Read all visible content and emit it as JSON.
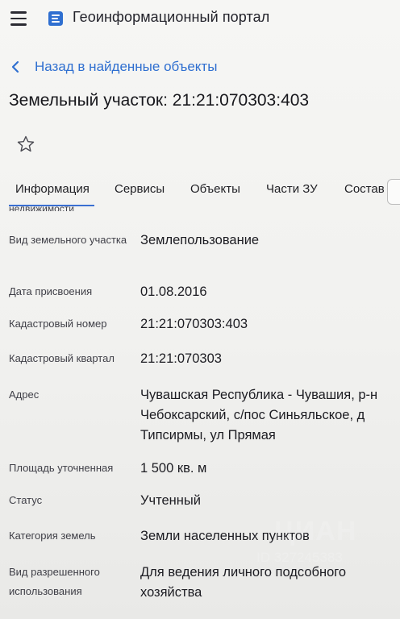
{
  "header": {
    "portal_title": "Геоинформационный портал",
    "menu_icon": "hamburger-menu-icon",
    "logo_icon": "portal-logo-icon"
  },
  "back": {
    "label": "Назад в найденные объекты",
    "icon": "chevron-left-icon"
  },
  "object": {
    "title": "Земельный участок: 21:21:070303:403",
    "favorite_icon": "star-outline-icon"
  },
  "tabs": {
    "items": [
      "Информация",
      "Сервисы",
      "Объекты",
      "Части ЗУ",
      "Состав"
    ],
    "active": "Информация",
    "overflow_label": "недвижимости"
  },
  "fields": [
    {
      "label": "Вид земельного участка",
      "value": "Землепользование"
    },
    {
      "label": "Дата присвоения",
      "value": "01.08.2016"
    },
    {
      "label": "Кадастровый номер",
      "value": "21:21:070303:403"
    },
    {
      "label": "Кадастровый квартал",
      "value": "21:21:070303"
    },
    {
      "label": "Адрес",
      "value": "Чувашская Республика - Чувашия, р-н Чебоксарский, с/пос Синьяльское, д Типсирмы, ул Прямая"
    },
    {
      "label": "Площадь уточненная",
      "value": "1 500 кв. м"
    },
    {
      "label": "Статус",
      "value": "Учтенный"
    },
    {
      "label": "Категория земель",
      "value": "Земли населенных пунктов"
    },
    {
      "label": "Вид разрешенного использования",
      "value": "Для ведения личного подсобного хозяйства"
    }
  ],
  "watermark": {
    "brand": "ЦИАН",
    "id": "ID 327245383"
  },
  "colors": {
    "link": "#2f6fd0",
    "tab_underline": "#3a6fd2",
    "logo": "#2f6fd0"
  }
}
